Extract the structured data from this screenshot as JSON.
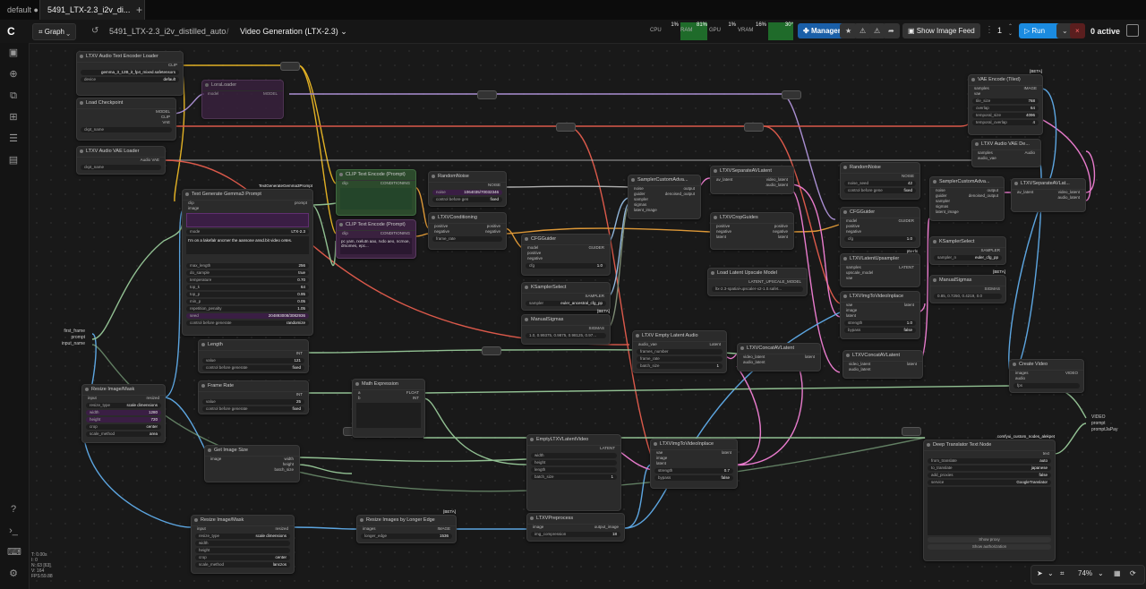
{
  "tabs": [
    {
      "label": "default"
    },
    {
      "label": "5491_LTX-2.3_i2v_di..."
    }
  ],
  "topbar": {
    "graph_label": "Graph",
    "workflow_name": "5491_LTX-2.3_i2v_distilled_auto",
    "separator": "/",
    "subgraph_name": "Video Generation (LTX-2.3)",
    "cpu_label": "CPU",
    "cpu_val": "1%",
    "ram_label": "RAM",
    "ram_val": "81%",
    "gpu_label": "GPU",
    "gpu_val": "1%",
    "vram_label": "VRAM",
    "vram_val": "16%",
    "temp_val": "30°",
    "manager_label": "Manager",
    "image_feed_label": "Show Image Feed",
    "queue_count": "1",
    "run_label": "Run",
    "active_label": "0 active"
  },
  "status": {
    "line1": "T: 0.00s",
    "line2": "I: 0",
    "line3": "N: 63 [63]",
    "line4": "V: 164",
    "line5": "FPS:59.88"
  },
  "zoom": "74%",
  "nodes": {
    "audio_text_encoder": {
      "title": "LTXV Audio Text Encoder Loader",
      "o1": "CLIP",
      "w1k": "",
      "w1v": "gemma_3_12B_it_fp4_mixed.safetensors",
      "w2k": "device",
      "w2v": "default",
      "w3k": "ckpt_name",
      "w3v": ""
    },
    "load_checkpoint": {
      "title": "Load Checkpoint",
      "o1": "MODEL",
      "o2": "CLIP",
      "o3": "VAE",
      "w1k": "ckpt_name",
      "w1v": ""
    },
    "audio_vae_loader": {
      "title": "LTXV Audio VAE Loader",
      "o1": "Audio VAE",
      "w1k": "ckpt_name",
      "w1v": ""
    },
    "lora_loader": {
      "title": "LoraLoader",
      "i1": "model",
      "o1": "MODEL"
    },
    "text_gen_prompt": {
      "title": "Text Generate Gemma3 Prompt",
      "badge": "TextGenerateGemma3Prompt",
      "i1": "clip",
      "i2": "image",
      "o1": "prompt",
      "w1k": "mode",
      "w1v": "LTX-2.3",
      "text": "I'm on a lakefalr ancmer the aansone ansd.bit video cetes.",
      "p": [
        [
          "max_length",
          "256"
        ],
        [
          "do_sample",
          "true"
        ],
        [
          "temperature",
          "0.70"
        ],
        [
          "top_k",
          "64"
        ],
        [
          "top_p",
          "0.95"
        ],
        [
          "min_p",
          "0.05"
        ],
        [
          "repetition_penalty",
          "1.05"
        ],
        [
          "seed",
          "204893008/3082936"
        ],
        [
          "control before generate",
          "randomize"
        ]
      ]
    },
    "clip_pos": {
      "title": "CLIP Text Encode (Prompt)",
      "i1": "clip",
      "o1": "CONDITIONING"
    },
    "clip_neg": {
      "title": "CLIP Text Encode (Prompt)",
      "i1": "clip",
      "o1": "CONDITIONING",
      "text": "pc yam, rxelutn aao, rvdo aeo, ncrnoe, drsomes, epc..."
    },
    "random_noise": {
      "title": "RandomNoise",
      "o1": "NOISE",
      "w1k": "noise",
      "w1v": "1064035/70032346",
      "w2k": "control before gen",
      "w2v": "fixed"
    },
    "ltxv_cond": {
      "title": "LTXVConditioning",
      "i1": "positive",
      "i2": "negative",
      "o1": "positive",
      "o2": "negative",
      "w1k": "frame_rate",
      "w1v": ""
    },
    "cfg_guider_1": {
      "title": "CFGGuider",
      "i1": "model",
      "i2": "positive",
      "i3": "negative",
      "o1": "GUIDER",
      "w1k": "cfg",
      "w1v": "1.0"
    },
    "ksampler_select_1": {
      "title": "KSamplerSelect",
      "o1": "SAMPLER",
      "w1k": "sampler",
      "w1v": "euler_ancestral_cfg_pp"
    },
    "manual_sigmas_1": {
      "title": "ManualSigmas",
      "badge": "[BETA]",
      "o1": "SIGMAS",
      "w1v": "1.0, 0.99375, 0.9875, 0.98125, 0.97..."
    },
    "sampler_custom_1": {
      "title": "SamplerCustomAdva...",
      "i1": "noise",
      "i2": "guider",
      "i3": "sampler",
      "i4": "sigmas",
      "i5": "latent_image",
      "o1": "output",
      "o2": "denoised_output"
    },
    "separate_av_1": {
      "title": "LTXVSeparateAVLatent",
      "i1": "av_latent",
      "o1": "video_latent",
      "o2": "audio_latent"
    },
    "crop_guides": {
      "title": "LTXVCropGuides",
      "i1": "positive",
      "i2": "negative",
      "i3": "latent",
      "o1": "positive",
      "o2": "negative",
      "o3": "latent"
    },
    "latent_upscale_loader": {
      "title": "Load Latent Upscale Model",
      "o1": "LATENT_UPSCALE_MODEL",
      "w1v": "ltx-2.3-spatial-upscaler-x2-1.0.safet..."
    },
    "empty_latent_audio": {
      "title": "LTXV Empty Latent Audio",
      "i1": "audio_vae",
      "o1": "Latent",
      "w1k": "frames_number",
      "w1v": "",
      "w2k": "frame_rate",
      "w2v": "",
      "w3k": "batch_size",
      "w3v": "1"
    },
    "concat_av_1": {
      "title": "LTXVConcatAVLatent",
      "i1": "video_latent",
      "i2": "audio_latent",
      "o1": "latent"
    },
    "random_noise_2": {
      "title": "RandomNoise",
      "o1": "NOISE",
      "w1k": "noise_seed",
      "w1v": "42",
      "w2k": "control before gene",
      "w2v": "fixed"
    },
    "cfg_guider_2": {
      "title": "CFGGuider",
      "i1": "model",
      "i2": "positive",
      "i3": "negative",
      "o1": "GUIDER",
      "w1k": "cfg",
      "w1v": "1.0",
      "badge": "ptx-rlx"
    },
    "latent_upsampler": {
      "title": "LTXVLatentUpsampler",
      "i1": "samples",
      "i2": "upscale_model",
      "i3": "vae",
      "o1": "LATENT"
    },
    "img_to_video_inplace_1": {
      "title": "LTXVImgToVideoInplace",
      "i1": "vae",
      "i2": "image",
      "i3": "latent",
      "o1": "latent",
      "w1k": "strength",
      "w1v": "1.0",
      "w2k": "bypass",
      "w2v": "false"
    },
    "concat_av_2": {
      "title": "LTXVConcatAVLatent",
      "i1": "video_latent",
      "i2": "audio_latent",
      "o1": "latent"
    },
    "sampler_custom_2": {
      "title": "SamplerCustomAdva...",
      "i1": "noise",
      "i2": "guider",
      "i3": "sampler",
      "i4": "sigmas",
      "i5": "latent_image",
      "o1": "output",
      "o2": "denoised_output"
    },
    "ksampler_select_2": {
      "title": "KSamplerSelect",
      "o1": "SAMPLER",
      "w1k": "sampler_n",
      "w1v": "euler_cfg_pp"
    },
    "manual_sigmas_2": {
      "title": "ManualSigmas",
      "badge": "[BETA]",
      "o1": "SIGMAS",
      "w1v": "0.85, 0.7250, 0.4219, 0.0"
    },
    "vae_encode_tiled": {
      "title": "VAE Encode (Tiled)",
      "badge": "[BETA]",
      "i1": "samples",
      "i2": "vae",
      "o1": "IMAGE",
      "p": [
        [
          "tile_size",
          "768"
        ],
        [
          "overlap",
          "64"
        ],
        [
          "temporal_size",
          "4096"
        ],
        [
          "temporal_overlap",
          "4"
        ]
      ]
    },
    "audio_vae_decode": {
      "title": "LTXV Audio VAE De...",
      "i1": "samples",
      "i2": "audio_vae",
      "o1": "Audio"
    },
    "separate_av_2": {
      "title": "LTXVSeparateAVLat...",
      "i1": "av_latent",
      "o1": "video_latent",
      "o2": "audio_latent"
    },
    "create_video": {
      "title": "Create Video",
      "i1": "images",
      "i2": "audio",
      "o1": "VIDEO",
      "w1k": "fps",
      "w1v": ""
    },
    "resize_image_mask_1": {
      "title": "Resize Image/Mask",
      "i1": "input",
      "o1": "resized",
      "p": [
        [
          "resize_type",
          "scale dimensions"
        ],
        [
          "width",
          "1280"
        ],
        [
          "height",
          "720"
        ],
        [
          "crop",
          "center"
        ],
        [
          "scale_method",
          "area"
        ]
      ]
    },
    "length": {
      "title": "Length",
      "o1": "INT",
      "w1k": "value",
      "w1v": "121",
      "w2k": "control before generate",
      "w2v": "fixed"
    },
    "frame_rate": {
      "title": "Frame Rate",
      "o1": "INT",
      "w1k": "value",
      "w1v": "25",
      "w2k": "control before generate",
      "w2v": "fixed"
    },
    "math_expression": {
      "title": "Math Expression",
      "i1": "a",
      "i2": "b",
      "o1": "FLOAT",
      "o2": "INT"
    },
    "get_image_size": {
      "title": "Get Image Size",
      "i1": "image",
      "o1": "width",
      "o2": "height",
      "o3": "batch_size"
    },
    "empty_ltxv_latent": {
      "title": "EmptyLTXVLatentVideo",
      "o1": "LATENT",
      "w1k": "width",
      "w2k": "height",
      "w3k": "length",
      "w4k": "batch_size",
      "w4v": "1"
    },
    "img_to_video_inplace_2": {
      "title": "LTXVImgToVideoInplace",
      "i1": "vae",
      "i2": "image",
      "i3": "latent",
      "o1": "latent",
      "w1k": "strength",
      "w1v": "0.7",
      "w2k": "bypass",
      "w2v": "false"
    },
    "resize_image_mask_2": {
      "title": "Resize Image/Mask",
      "i1": "input",
      "o1": "resized",
      "p": [
        [
          "resize_type",
          "scale dimensions"
        ],
        [
          "width",
          ""
        ],
        [
          "height",
          ""
        ],
        [
          "crop",
          "center"
        ],
        [
          "scale_method",
          "lanczos"
        ]
      ]
    },
    "resize_longer_edge": {
      "title": "Resize Images by Longer Edge",
      "badge": "[BETA]",
      "i1": "images",
      "o1": "IMAGE",
      "w1k": "longer_edge",
      "w1v": "1536"
    },
    "ltxv_preprocess": {
      "title": "LTXVPreprocess",
      "i1": "image",
      "o1": "output_image",
      "w1k": "img_compression",
      "w1v": "18"
    },
    "deep_translator": {
      "title": "Deep Translator Text Node",
      "badge": "comfyui_custom_nodes_alekpet",
      "o1": "text",
      "p": [
        [
          "from_translate",
          "auto"
        ],
        [
          "to_translate",
          "japanese"
        ],
        [
          "add_proxies",
          "false"
        ],
        [
          "service",
          "GoogleTranslator"
        ]
      ],
      "b1": "Show proxy",
      "b2": "Show authorization"
    },
    "subgraph_inputs": {
      "i1": "first_frame",
      "i2": "prompt",
      "i3": "input_name"
    },
    "subgraph_outputs": {
      "o1": "VIDEO",
      "o2": "prompt",
      "o3": "promptJaPay"
    }
  }
}
